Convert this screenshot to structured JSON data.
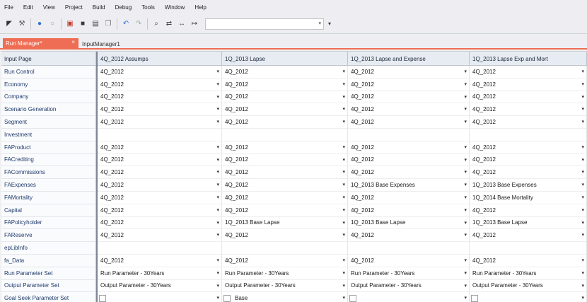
{
  "menu": [
    "File",
    "Edit",
    "View",
    "Project",
    "Build",
    "Debug",
    "Tools",
    "Window",
    "Help"
  ],
  "toolbar": {
    "icons": [
      "pointer-icon",
      "tools-icon",
      "run-icon",
      "stop-icon",
      "open-icon",
      "save-icon",
      "save-all-icon",
      "copy-icon",
      "undo-icon",
      "redo-icon",
      "find-icon",
      "replace-icon",
      "compare-icon",
      "merge-icon"
    ],
    "combo_value": "",
    "tail": "▾"
  },
  "tabs": {
    "active": {
      "label": "Run Manager*",
      "close": "×"
    },
    "inactive": {
      "label": "InputManager1"
    }
  },
  "grid": {
    "columns": [
      "Input Page",
      "4Q_2012 Assumps",
      "1Q_2013 Lapse",
      "1Q_2013 Lapse and Expense",
      "1Q_2013 Lapse Exp and Mort"
    ],
    "rows": [
      {
        "label": "Run Control",
        "cells": [
          "4Q_2012",
          "4Q_2012",
          "4Q_2012",
          "4Q_2012"
        ]
      },
      {
        "label": "Economy",
        "cells": [
          "4Q_2012",
          "4Q_2012",
          "4Q_2012",
          "4Q_2012"
        ]
      },
      {
        "label": "Company",
        "cells": [
          "4Q_2012",
          "4Q_2012",
          "4Q_2012",
          "4Q_2012"
        ]
      },
      {
        "label": "Scenario Generation",
        "cells": [
          "4Q_2012",
          "4Q_2012",
          "4Q_2012",
          "4Q_2012"
        ]
      },
      {
        "label": "Segment",
        "cells": [
          "4Q_2012",
          "4Q_2012",
          "4Q_2012",
          "4Q_2012"
        ]
      },
      {
        "label": "Investment",
        "cells": [
          null,
          null,
          null,
          null
        ]
      },
      {
        "label": "FAProduct",
        "cells": [
          "4Q_2012",
          "4Q_2012",
          "4Q_2012",
          "4Q_2012"
        ]
      },
      {
        "label": "FACrediting",
        "cells": [
          "4Q_2012",
          "4Q_2012",
          "4Q_2012",
          "4Q_2012"
        ]
      },
      {
        "label": "FACommissions",
        "cells": [
          "4Q_2012",
          "4Q_2012",
          "4Q_2012",
          "4Q_2012"
        ]
      },
      {
        "label": "FAExpenses",
        "cells": [
          "4Q_2012",
          "4Q_2012",
          "1Q_2013 Base Expenses",
          "1Q_2013 Base Expenses"
        ]
      },
      {
        "label": "FAMortality",
        "cells": [
          "4Q_2012",
          "4Q_2012",
          "4Q_2012",
          "1Q_2014 Base Mortality"
        ]
      },
      {
        "label": "Capital",
        "cells": [
          "4Q_2012",
          "4Q_2012",
          "4Q_2012",
          "4Q_2012"
        ]
      },
      {
        "label": "FAPolicyholder",
        "cells": [
          "4Q_2012",
          "1Q_2013 Base Lapse",
          "1Q_2013 Base Lapse",
          "1Q_2013 Base Lapse"
        ]
      },
      {
        "label": "FAReserve",
        "cells": [
          "4Q_2012",
          "4Q_2012",
          "4Q_2012",
          "4Q_2012"
        ]
      },
      {
        "label": "epLibInfo",
        "cells": [
          null,
          null,
          null,
          null
        ]
      },
      {
        "label": "fa_Data",
        "cells": [
          "4Q_2012",
          "4Q_2012",
          "4Q_2012",
          "4Q_2012"
        ]
      },
      {
        "label": "Run Parameter Set",
        "cells": [
          "Run Parameter - 30Years",
          "Run Parameter - 30Years",
          "Run Parameter - 30Years",
          "Run Parameter - 30Years"
        ]
      },
      {
        "label": "Output Parameter Set",
        "cells": [
          "Output Parameter - 30Years",
          "Output Parameter - 30Years",
          "Output Parameter - 30Years",
          "Output Parameter - 30Years"
        ]
      },
      {
        "label": "Goal Seek Parameter Set",
        "cells": [
          "",
          "Base",
          "",
          ""
        ]
      }
    ],
    "dropdown_glyph": "▾"
  }
}
